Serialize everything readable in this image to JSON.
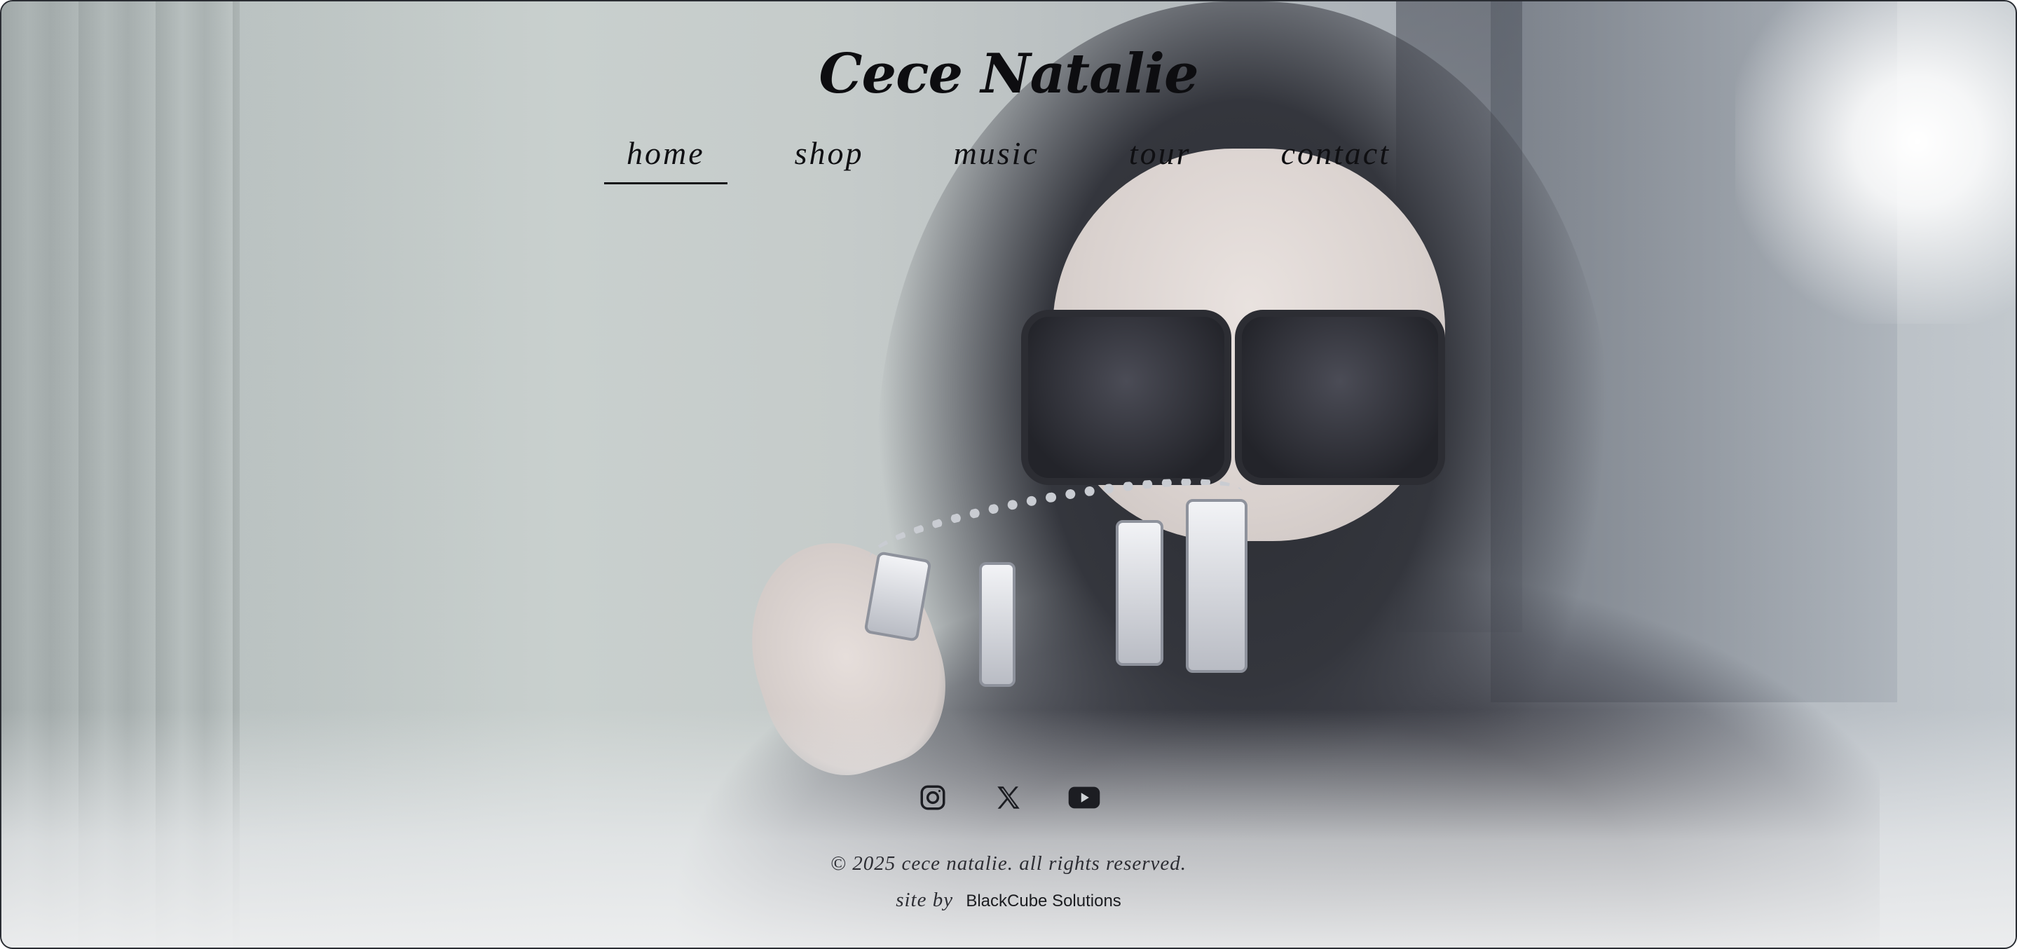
{
  "site": {
    "logo_text": "Cece Natalie"
  },
  "nav": {
    "items": [
      {
        "label": "home",
        "active": true
      },
      {
        "label": "shop",
        "active": false
      },
      {
        "label": "music",
        "active": false
      },
      {
        "label": "tour",
        "active": false
      },
      {
        "label": "contact",
        "active": false
      }
    ]
  },
  "social": {
    "icons": [
      "instagram-icon",
      "x-icon",
      "youtube-icon"
    ]
  },
  "footer": {
    "copyright": "© 2025 cece natalie. all rights reserved.",
    "credit_prefix": "site by",
    "credit_brand": "BlackCube Solutions"
  },
  "colors": {
    "text": "#0f0f12",
    "footer_text": "#2c2d33"
  }
}
